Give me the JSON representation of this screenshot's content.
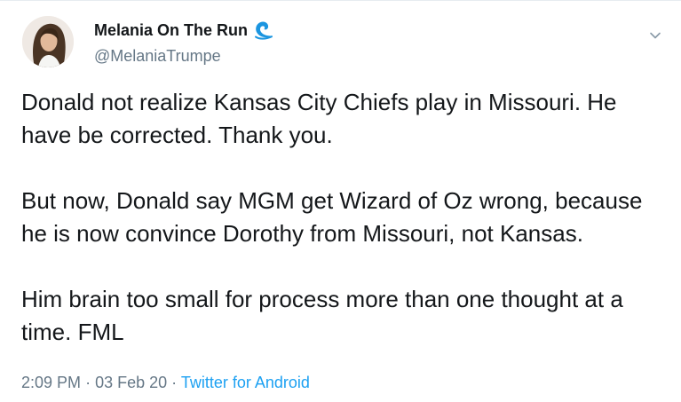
{
  "tweet": {
    "author": {
      "display_name": "Melania On The Run",
      "handle": "@MelaniaTrumpe",
      "badge_icon": "wave-icon"
    },
    "paragraphs": [
      "Donald not realize Kansas City Chiefs play in Missouri. He have be corrected.  Thank you.",
      "But now, Donald say MGM get Wizard of Oz wrong, because he is now convince Dorothy from Missouri, not Kansas.",
      "Him brain too small for process more than one thought at a time.  FML"
    ],
    "time": "2:09 PM",
    "separator": "·",
    "date": "03 Feb 20",
    "source": "Twitter for Android"
  },
  "colors": {
    "text": "#14171a",
    "secondary": "#657786",
    "link": "#1da1f2",
    "wave": "#1b95e0"
  }
}
